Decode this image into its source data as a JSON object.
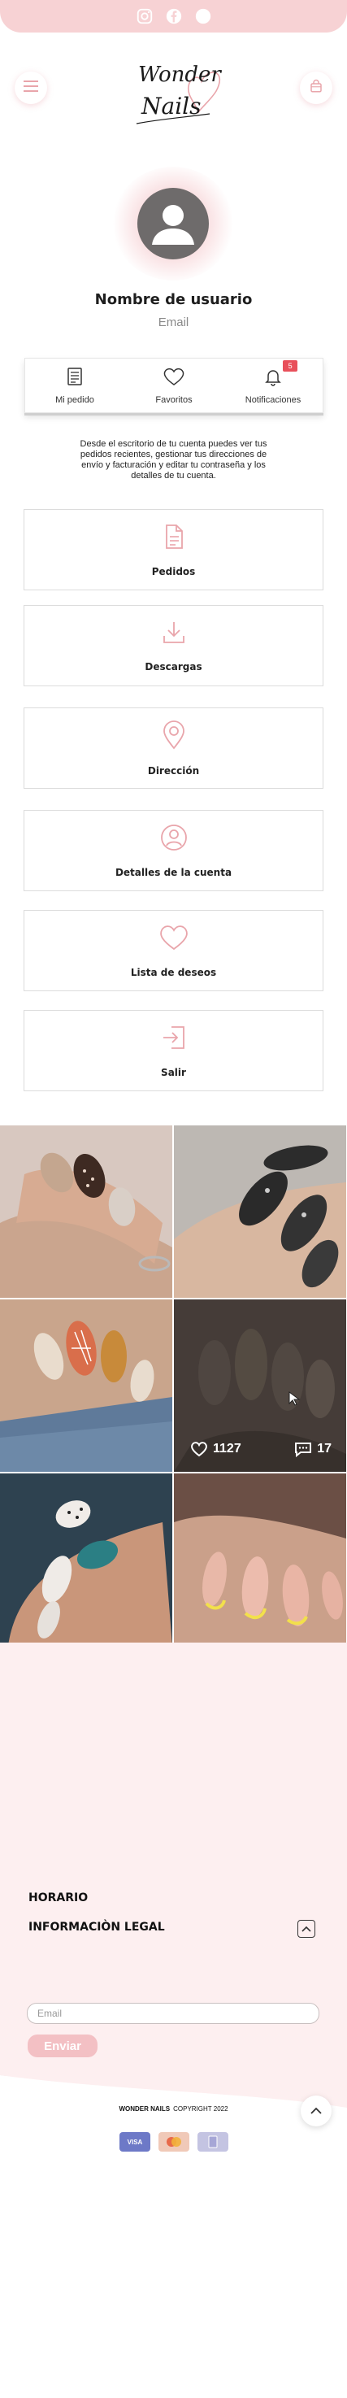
{
  "social": {
    "icons": [
      "instagram-icon",
      "facebook-icon",
      "circle-icon"
    ]
  },
  "header": {
    "logo_line1": "Wonder",
    "logo_line2": "Nails"
  },
  "profile": {
    "username": "Nombre de usuario",
    "email_label": "Email"
  },
  "tabs": [
    {
      "label": "Mi pedido",
      "icon": "order-list-icon"
    },
    {
      "label": "Favoritos",
      "icon": "heart-icon"
    },
    {
      "label": "Notificaciones",
      "icon": "bell-icon",
      "badge": "5"
    }
  ],
  "description": "Desde el escritorio de tu cuenta puedes ver tus pedidos recientes, gestionar tus direcciones de envío y facturación y editar tu contraseña y los detalles de tu cuenta.",
  "menu": [
    {
      "label": "Pedidos",
      "icon": "document-icon"
    },
    {
      "label": "Descargas",
      "icon": "download-icon"
    },
    {
      "label": "Dirección",
      "icon": "location-pin-icon"
    },
    {
      "label": "Detalles de la cuenta",
      "icon": "user-circle-icon"
    },
    {
      "label": "Lista de deseos",
      "icon": "heart-icon"
    },
    {
      "label": "Salir",
      "icon": "logout-icon"
    }
  ],
  "gallery": {
    "likes": "1127",
    "comments": "17"
  },
  "footer": {
    "horario": "HORARIO",
    "legal": "INFORMACIÒN LEGAL",
    "email_placeholder": "Email",
    "send_label": "Enviar",
    "brand": "WONDER NAILS",
    "copyright": "COPYRIGHT 2022",
    "payments": [
      "VISA",
      "",
      ""
    ]
  },
  "colors": {
    "accent": "#f3c0c4",
    "pink_light": "#fdeff0",
    "icon_pink": "#e9a5ab",
    "badge": "#e8505b"
  }
}
